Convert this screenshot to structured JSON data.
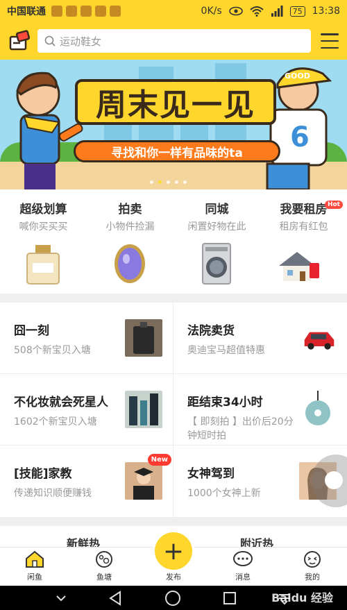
{
  "status_bar": {
    "carrier": "中国联通",
    "speed": "0K/s",
    "battery": "75",
    "time": "13:38"
  },
  "header": {
    "search_placeholder": "运动鞋女"
  },
  "banner": {
    "title": "周末见一见",
    "subtitle": "寻找和你一样有品味的ta",
    "shirt_text": "GOOD",
    "shirt_number": "6",
    "active_dot": 1,
    "dot_count": 5
  },
  "categories": [
    {
      "name": "超级划算",
      "desc": "喊你买买买"
    },
    {
      "name": "拍卖",
      "desc": "小物件捡漏"
    },
    {
      "name": "同城",
      "desc": "闲置好物在此"
    },
    {
      "name": "我要租房",
      "desc": "租房有红包",
      "badge": "Hot"
    }
  ],
  "grid": [
    {
      "title": "囧一刻",
      "sub": "508个新宝贝入塘"
    },
    {
      "title": "法院卖货",
      "sub": "奥迪宝马超值特惠"
    },
    {
      "title": "不化妆就会死星人",
      "sub": "1602个新宝贝入塘"
    },
    {
      "title": "距结束34小时",
      "sub": "【 即刻拍 】出价后20分钟短时拍"
    },
    {
      "title": "[技能]家教",
      "sub": "传递知识顺便赚钱",
      "badge": "New"
    },
    {
      "title": "女神驾到",
      "sub": "1000个女神上新"
    }
  ],
  "section_peek": {
    "left": "新鲜热",
    "right": "附近热"
  },
  "tabbar": [
    {
      "label": "闲鱼",
      "icon": "home-icon"
    },
    {
      "label": "鱼塘",
      "icon": "pond-icon"
    },
    {
      "label": "发布",
      "icon": "plus-icon"
    },
    {
      "label": "消息",
      "icon": "message-icon"
    },
    {
      "label": "我的",
      "icon": "profile-icon"
    }
  ],
  "watermark": "Baidu 经验",
  "colors": {
    "brand_yellow": "#ffd62b",
    "hot_red": "#ff4a3d"
  }
}
